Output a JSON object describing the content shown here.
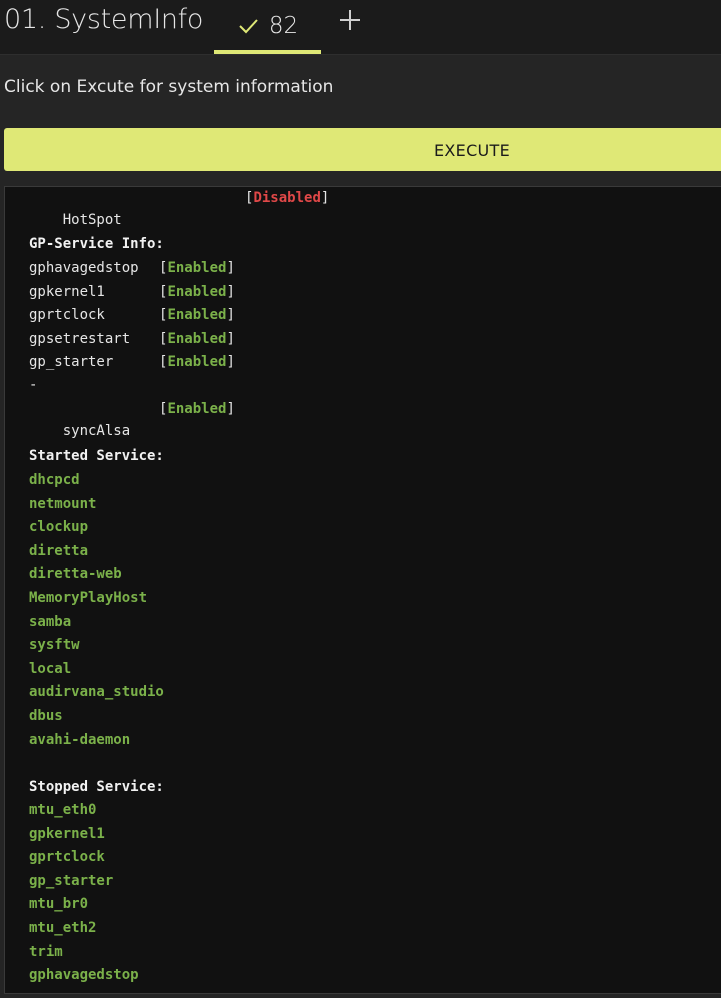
{
  "header": {
    "app_title": "01. SystemInfo",
    "tab_label": "82",
    "tab_icon": "check-icon",
    "add_icon": "plus-icon"
  },
  "main": {
    "instructions": "Click on Excute for system information",
    "execute_label": "EXECUTE"
  },
  "output": {
    "hotspot": {
      "name": "HotSpot",
      "status": "Disabled"
    },
    "gp_heading": "GP-Service Info:",
    "gp_services": [
      {
        "name": "gphavagedstop",
        "status": "Enabled"
      },
      {
        "name": "gpkernel1",
        "status": "Enabled"
      },
      {
        "name": "gprtclock",
        "status": "Enabled"
      },
      {
        "name": "gpsetrestart",
        "status": "Enabled"
      },
      {
        "name": "gp_starter",
        "status": "Enabled"
      }
    ],
    "separator": "-",
    "sync": {
      "name": "syncAlsa",
      "status": "Enabled"
    },
    "started_heading": "Started Service:",
    "started": [
      "dhcpcd",
      "netmount",
      "clockup",
      "diretta",
      "diretta-web",
      "MemoryPlayHost",
      "samba",
      "sysftw",
      "local",
      "audirvana_studio",
      "dbus",
      "avahi-daemon"
    ],
    "stopped_heading": "Stopped Service:",
    "stopped": [
      "mtu_eth0",
      "gpkernel1",
      "gprtclock",
      "gp_starter",
      "mtu_br0",
      "mtu_eth2",
      "trim",
      "gphavagedstop"
    ]
  },
  "colors": {
    "accent": "#dfe876",
    "enabled": "#7bb14a",
    "disabled": "#e04848"
  }
}
